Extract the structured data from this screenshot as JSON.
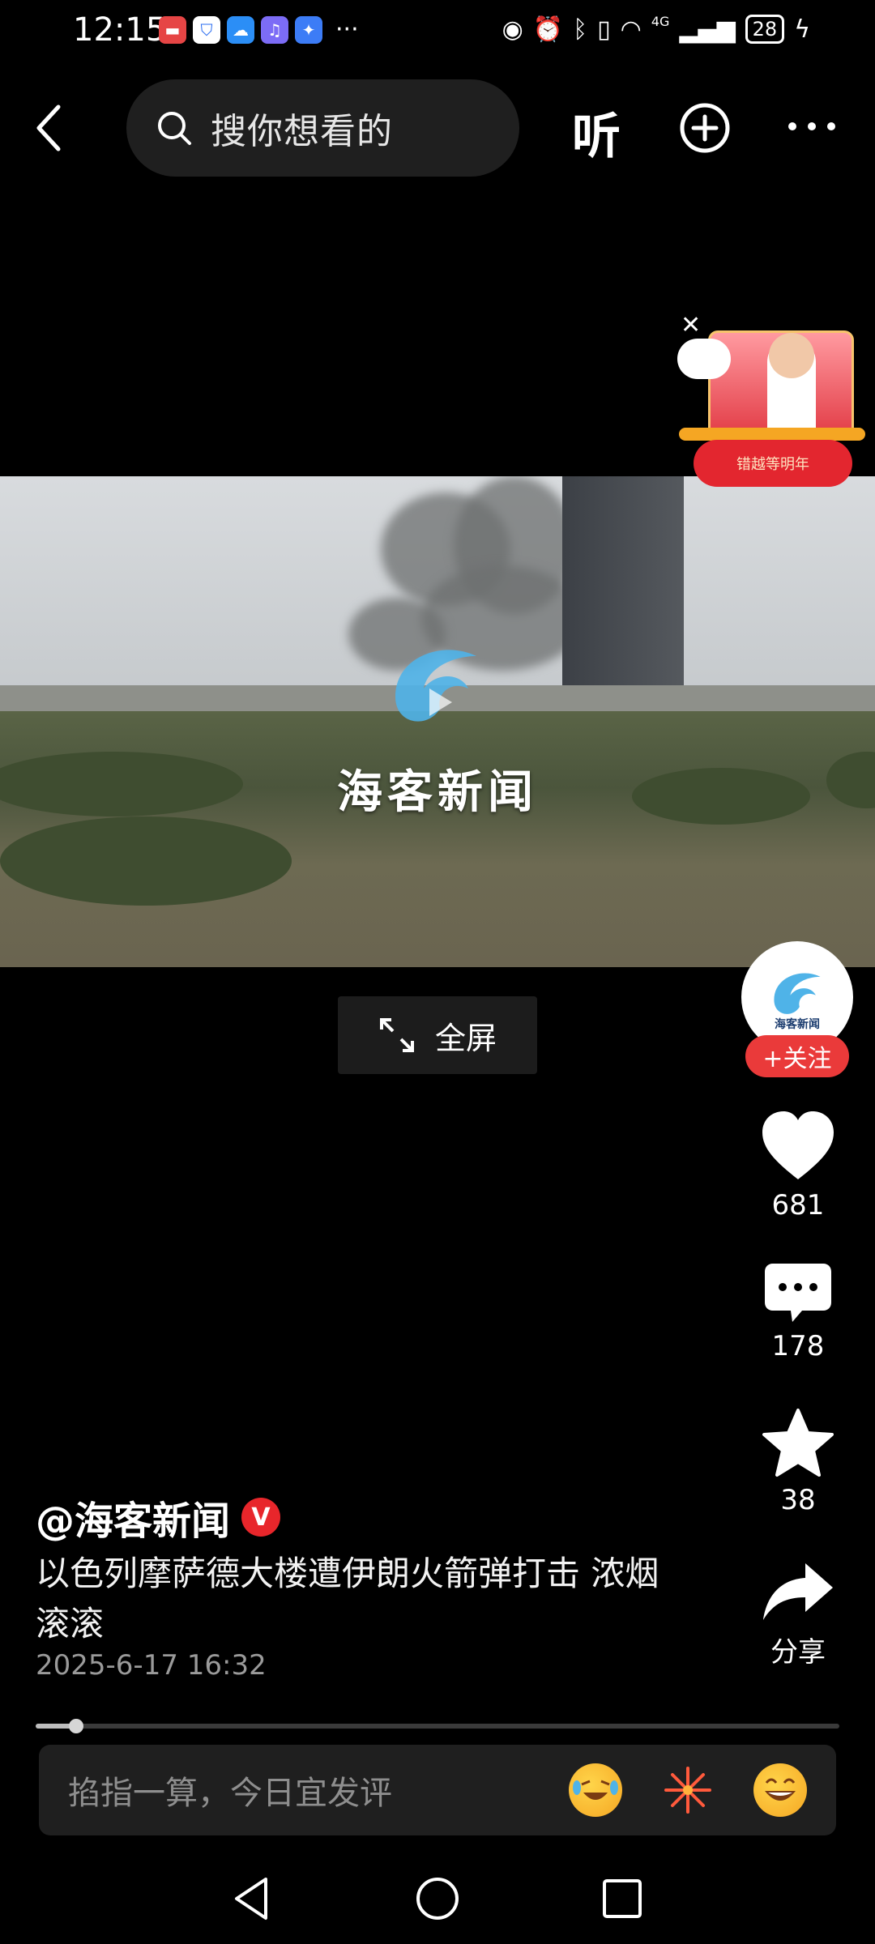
{
  "status_bar": {
    "time": "12:15",
    "more": "···",
    "network": "4G",
    "battery": "28",
    "app_icons": [
      "huawei-icon",
      "shield-icon",
      "weather-icon",
      "music-icon",
      "bulb-icon"
    ]
  },
  "top_nav": {
    "search_placeholder": "搜你想看的",
    "listen_label": "听"
  },
  "ad": {
    "button_label": "错越等明年"
  },
  "video": {
    "watermark_text": "海客新闻",
    "fullscreen_label": "全屏",
    "progress_fraction": 0.05
  },
  "avatar": {
    "label": "海客新闻"
  },
  "actions": {
    "follow_label": "+关注",
    "likes": "681",
    "comments": "178",
    "favorites": "38",
    "share_label": "分享"
  },
  "post": {
    "author": "@海客新闻",
    "verified_mark": "V",
    "caption": "以色列摩萨德大楼遭伊朗火箭弹打击 浓烟滚滚",
    "date": "2025-6-17 16:32"
  },
  "comment": {
    "placeholder": "掐指一算，今日宜发评"
  },
  "colors": {
    "accent_red": "#ea3a3a",
    "background": "#000000",
    "surface": "#1f1f1f"
  }
}
